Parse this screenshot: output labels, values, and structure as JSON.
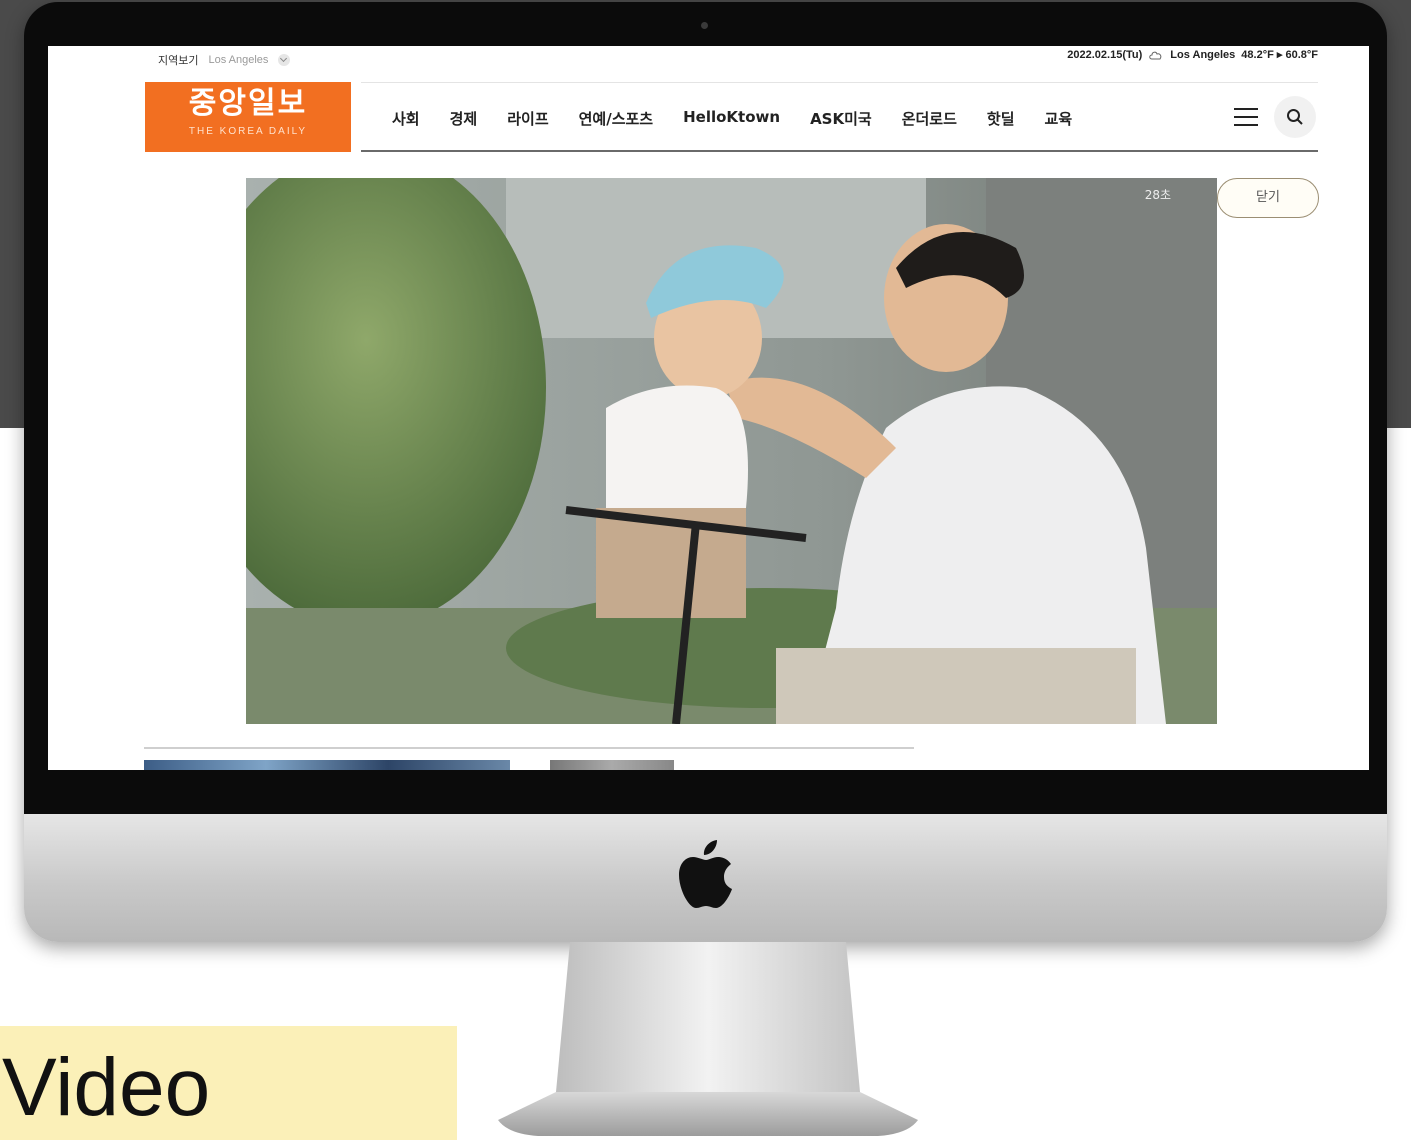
{
  "top_bar": {
    "region_label": "지역보기",
    "region_value": "Los Angeles",
    "date": "2022.02.15(Tu)",
    "weather_city": "Los Angeles",
    "weather_temp": "48.2°F ▸ 60.8°F"
  },
  "logo": {
    "korean": "중앙일보",
    "english": "THE KOREA DAILY"
  },
  "nav": {
    "items": [
      "사회",
      "경제",
      "라이프",
      "연예/스포츠",
      "HelloKtown",
      "ASK미국",
      "온더로드",
      "핫딜",
      "교육"
    ]
  },
  "icons": {
    "menu": "hamburger-menu-icon",
    "search": "search-icon",
    "weather": "cloud-icon",
    "dropdown": "chevron-down-icon",
    "brand": "apple-logo"
  },
  "video": {
    "countdown": "28초",
    "close_label": "닫기"
  },
  "caption": "Video",
  "colors": {
    "brand_orange": "#f26f21",
    "caption_bg": "#fbf0b8",
    "backdrop": "#4a4a4a"
  }
}
